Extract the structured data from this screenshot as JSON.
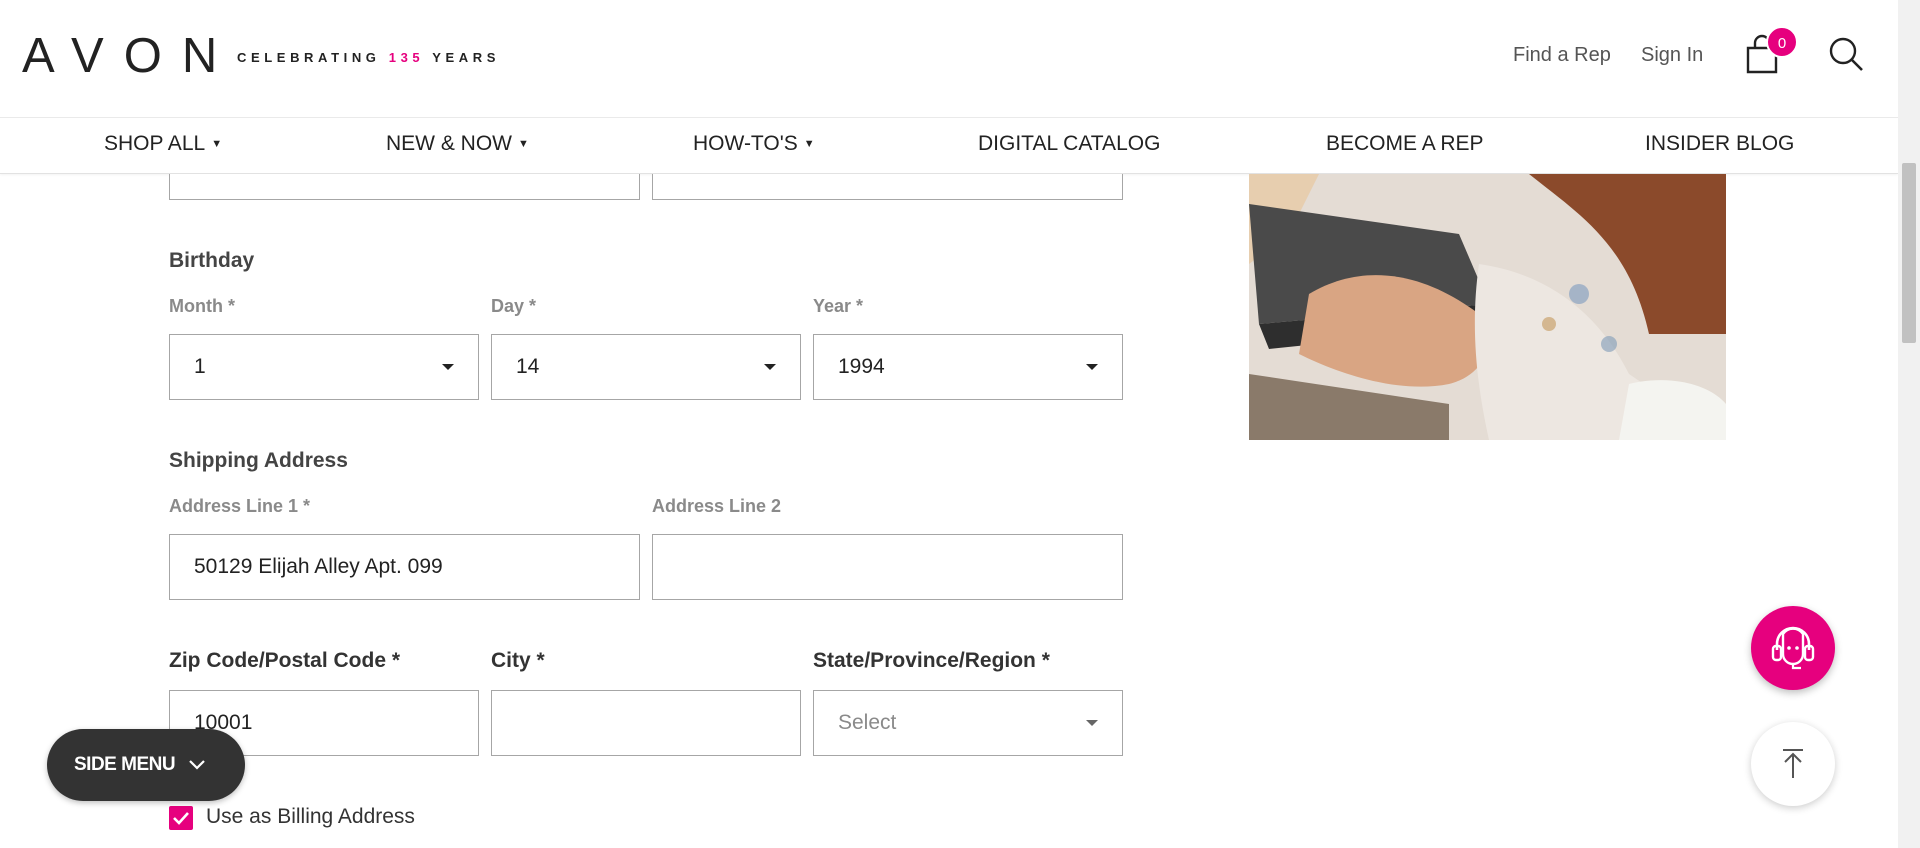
{
  "header": {
    "logo_text": "AVON",
    "celebrating_prefix": "CELEBRATING ",
    "celebrating_number": "135",
    "celebrating_suffix": " YEARS",
    "find_rep": "Find a Rep",
    "sign_in": "Sign In",
    "cart_count": "0",
    "accent_color": "#e6007e"
  },
  "nav": {
    "items": [
      {
        "label": "SHOP ALL",
        "caret": "▼"
      },
      {
        "label": "NEW & NOW",
        "caret": "▼"
      },
      {
        "label": "HOW-TO'S",
        "caret": "▼"
      },
      {
        "label": "DIGITAL CATALOG"
      },
      {
        "label": "BECOME A REP"
      },
      {
        "label": "INSIDER BLOG"
      }
    ]
  },
  "form": {
    "birthday": {
      "title": "Birthday",
      "month_label": "Month *",
      "month_value": "1",
      "day_label": "Day *",
      "day_value": "14",
      "year_label": "Year *",
      "year_value": "1994"
    },
    "shipping": {
      "title": "Shipping Address",
      "address1_label": "Address Line 1 *",
      "address1_value": "50129 Elijah Alley Apt. 099",
      "address2_label": "Address Line 2",
      "address2_value": "",
      "zip_label": "Zip Code/Postal Code *",
      "zip_value": "10001",
      "city_label": "City *",
      "city_value": "",
      "state_label": "State/Province/Region *",
      "state_placeholder": "Select"
    },
    "billing_checkbox_label": "Use as Billing Address",
    "billing_checked": true
  },
  "floating": {
    "side_menu_label": "SIDE MENU",
    "support_icon": "headset-icon",
    "back_to_top_icon": "arrow-up-icon"
  }
}
